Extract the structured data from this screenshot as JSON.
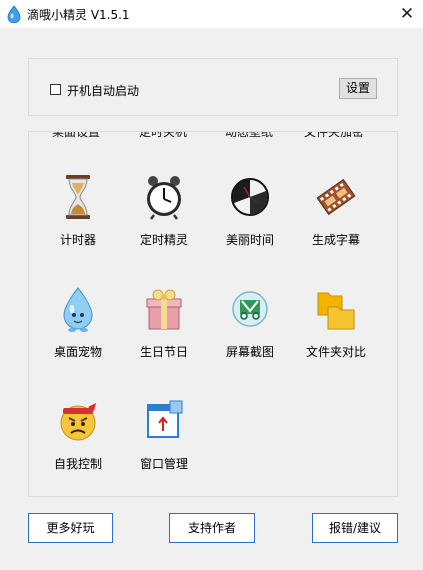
{
  "window": {
    "title": "滴哦小精灵 V1.5.1",
    "close_glyph": "✕"
  },
  "settings": {
    "autostart_label": "开机自动启动",
    "autostart_checked": false,
    "settings_button": "设置"
  },
  "partial_row": [
    "桌面设置",
    "定时关机",
    "动态壁纸",
    "文件夹加密"
  ],
  "tools": [
    {
      "label": "计时器",
      "icon": "hourglass-icon"
    },
    {
      "label": "定时精灵",
      "icon": "alarm-clock-icon"
    },
    {
      "label": "美丽时间",
      "icon": "wall-clock-icon"
    },
    {
      "label": "生成字幕",
      "icon": "film-reel-icon"
    },
    {
      "label": "桌面宠物",
      "icon": "water-drop-pet-icon"
    },
    {
      "label": "生日节日",
      "icon": "gift-box-icon"
    },
    {
      "label": "屏幕截图",
      "icon": "screenshot-scissors-icon"
    },
    {
      "label": "文件夹对比",
      "icon": "folders-icon"
    },
    {
      "label": "自我控制",
      "icon": "angry-face-icon"
    },
    {
      "label": "窗口管理",
      "icon": "window-manager-icon"
    }
  ],
  "buttons": {
    "more_fun": "更多好玩",
    "support_author": "支持作者",
    "report": "报错/建议"
  },
  "colors": {
    "button_border": "#2b6fc6",
    "background": "#f0f0f0"
  }
}
